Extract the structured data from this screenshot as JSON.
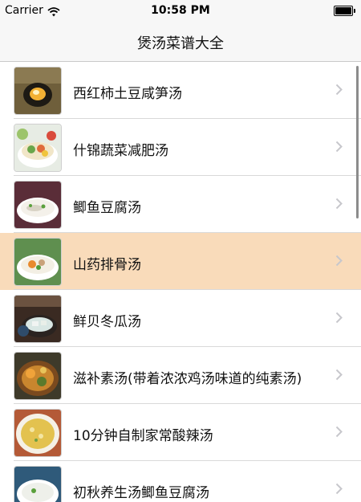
{
  "status_bar": {
    "carrier": "Carrier",
    "time": "10:58 PM"
  },
  "nav": {
    "title": "煲汤菜谱大全"
  },
  "recipes": [
    {
      "title": "西红柿土豆咸笋汤"
    },
    {
      "title": "什锦蔬菜减肥汤"
    },
    {
      "title": "鲫鱼豆腐汤"
    },
    {
      "title": "山药排骨汤"
    },
    {
      "title": "鲜贝冬瓜汤"
    },
    {
      "title": "滋补素汤(带着浓浓鸡汤味道的纯素汤)"
    },
    {
      "title": "10分钟自制家常酸辣汤"
    },
    {
      "title": "初秋养生汤鲫鱼豆腐汤"
    }
  ],
  "colors": {
    "selected_row": "#f9dbba",
    "nav_background": "#f7f7f7"
  },
  "icons": {
    "row_accessory": "chevron-right-icon",
    "wifi": "wifi-icon",
    "battery": "battery-icon"
  }
}
